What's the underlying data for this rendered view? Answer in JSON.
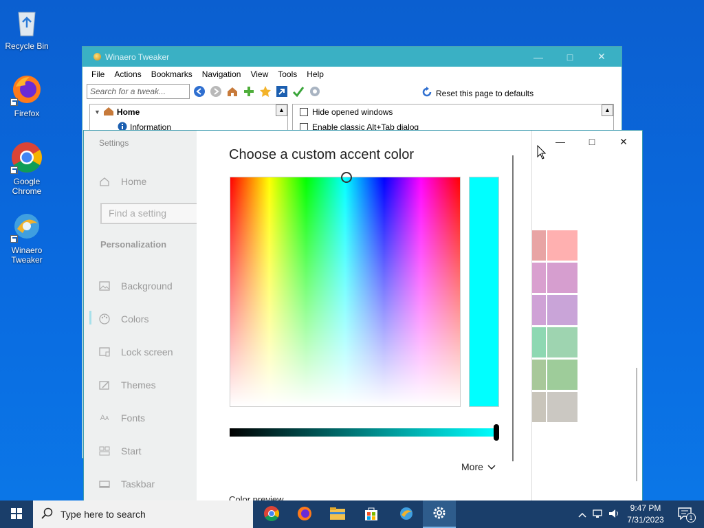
{
  "desktop": {
    "icons": [
      {
        "label": "Recycle Bin"
      },
      {
        "label": "Firefox"
      },
      {
        "label": "Google Chrome"
      },
      {
        "label": "Winaero Tweaker"
      }
    ]
  },
  "winaero": {
    "title": "Winaero Tweaker",
    "menu": [
      "File",
      "Actions",
      "Bookmarks",
      "Navigation",
      "View",
      "Tools",
      "Help"
    ],
    "search_placeholder": "Search for a tweak...",
    "reset_label": "Reset this page to defaults",
    "tree": [
      {
        "label": "Home"
      },
      {
        "label": "Information"
      }
    ],
    "options": [
      {
        "label": "Hide opened windows",
        "checked": false
      },
      {
        "label": "Enable classic Alt+Tab dialog",
        "checked": false
      }
    ]
  },
  "settings": {
    "app_title": "Settings",
    "home": "Home",
    "find_placeholder": "Find a setting",
    "category": "Personalization",
    "nav": [
      {
        "label": "Background",
        "icon": "image-icon"
      },
      {
        "label": "Colors",
        "icon": "palette-icon",
        "selected": true
      },
      {
        "label": "Lock screen",
        "icon": "lock-screen-icon"
      },
      {
        "label": "Themes",
        "icon": "themes-icon"
      },
      {
        "label": "Fonts",
        "icon": "fonts-icon"
      },
      {
        "label": "Start",
        "icon": "start-icon"
      },
      {
        "label": "Taskbar",
        "icon": "taskbar-icon"
      }
    ],
    "dialog": {
      "heading": "Choose a custom accent color",
      "selected_color": "#00FFFF",
      "more_label": "More",
      "preview_label": "Color preview"
    },
    "accent_swatches": [
      [
        "#e8a4a4",
        "#ffb0b0"
      ],
      [
        "#d9a0cf",
        "#d69ecf"
      ],
      [
        "#cfa2d6",
        "#c9a4d8"
      ],
      [
        "#8ed8b2",
        "#9ed4b0"
      ],
      [
        "#a8c89a",
        "#9ecc9a"
      ],
      [
        "#c9c5bb",
        "#cbc8c2"
      ]
    ]
  },
  "taskbar": {
    "search_placeholder": "Type here to search",
    "apps": [
      "chrome-icon",
      "firefox-icon",
      "file-explorer-icon",
      "store-icon",
      "winaero-icon",
      "settings-gear-icon"
    ],
    "time": "9:47 PM",
    "date": "7/31/2023",
    "notification_count": "1"
  }
}
